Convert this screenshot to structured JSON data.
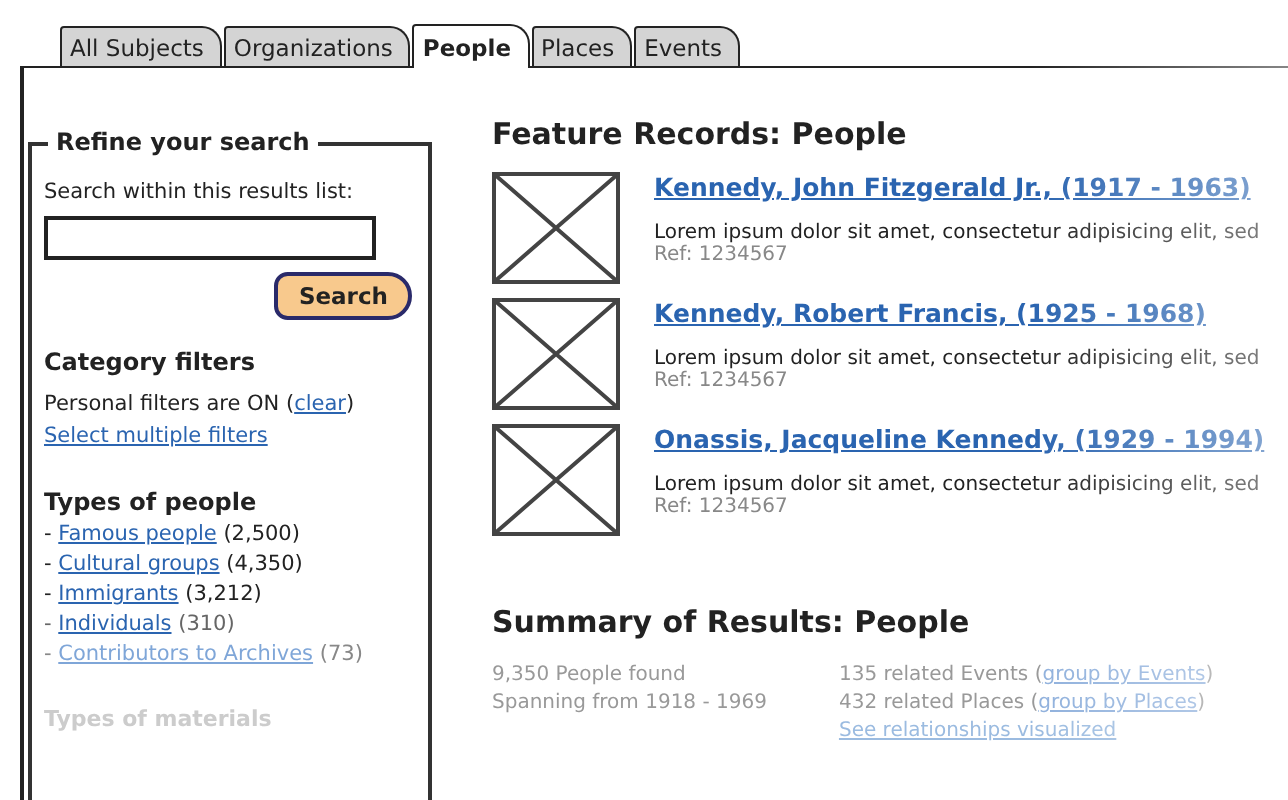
{
  "tabs": [
    {
      "label": "All Subjects",
      "selected": false
    },
    {
      "label": "Organizations",
      "selected": false
    },
    {
      "label": "People",
      "selected": true
    },
    {
      "label": "Places",
      "selected": false
    },
    {
      "label": "Events",
      "selected": false
    }
  ],
  "sidebar": {
    "title": "Refine your search",
    "search_label": "Search within this results list:",
    "search_button": "Search",
    "category_title": "Category filters",
    "personal_filters": {
      "prefix": "Personal filters are ON  (",
      "link": "clear",
      "suffix": ")"
    },
    "multi_link": "Select multiple filters",
    "types_title": "Types of people",
    "types": [
      {
        "bullet": "-",
        "link": "Famous people",
        "count": "(2,500)"
      },
      {
        "bullet": "-",
        "link": "Cultural groups",
        "count": "(4,350)"
      },
      {
        "bullet": "-",
        "link": "Immigrants",
        "count": "(3,212)"
      },
      {
        "bullet": "-",
        "link": "Individuals",
        "count": "(310)"
      },
      {
        "bullet": "-",
        "link": "Contributors to Archives",
        "count": "(73)"
      }
    ],
    "materials_title": "Types of materials"
  },
  "features": {
    "title": "Feature Records: People",
    "records": [
      {
        "name": "Kennedy, John Fitzgerald Jr., (1917 - 1963)",
        "description": "Lorem ipsum dolor sit amet, consectetur adipisicing elit, sed",
        "ref": "Ref: 1234567"
      },
      {
        "name": "Kennedy, Robert Francis, (1925 - 1968)",
        "description": "Lorem ipsum dolor sit amet, consectetur adipisicing elit, sed",
        "ref": "Ref: 1234567"
      },
      {
        "name": "Onassis, Jacqueline Kennedy, (1929 - 1994)",
        "description": "Lorem ipsum dolor sit amet, consectetur adipisicing elit, sed",
        "ref": "Ref: 1234567"
      }
    ]
  },
  "summary": {
    "title": "Summary of Results: People",
    "facts": [
      "9,350 People found",
      "Spanning from 1918 - 1969"
    ],
    "related": [
      {
        "prefix": "135 related Events (",
        "link": "group by Events",
        "suffix": ")"
      },
      {
        "prefix": "432 related Places (",
        "link": "group by Places",
        "suffix": ")"
      }
    ],
    "visualize_link": "See relationships visualized"
  }
}
